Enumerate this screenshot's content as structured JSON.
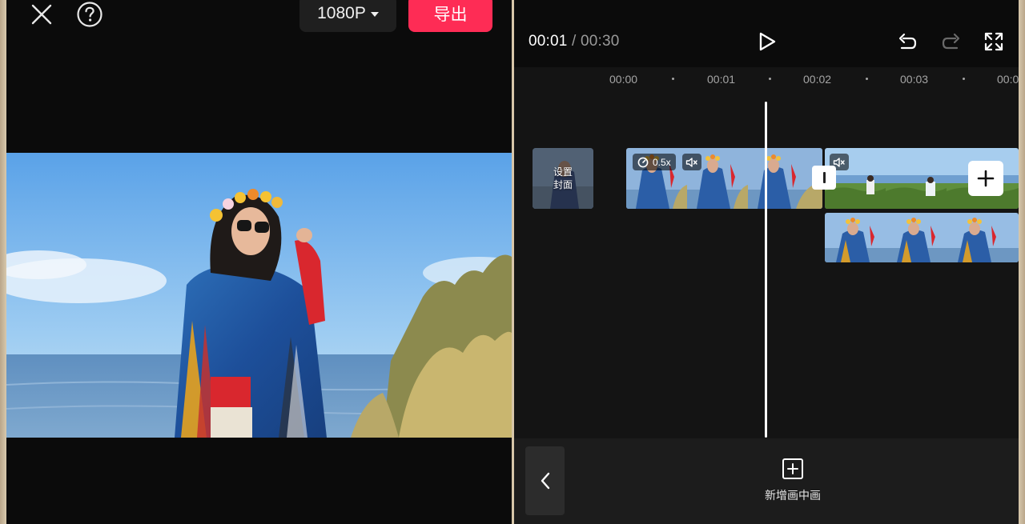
{
  "export_panel": {
    "resolution_label": "1080P",
    "export_label": "导出"
  },
  "player": {
    "current_time": "00:01",
    "separator": "/",
    "total_time": "00:30"
  },
  "timeline": {
    "ruler": [
      "00:00",
      "00:01",
      "00:02",
      "00:03",
      "00:0"
    ],
    "cover_label_line1": "设置",
    "cover_label_line2": "封面",
    "speed_value": "0.5x"
  },
  "bottom": {
    "pip_label": "新增画中画"
  },
  "colors": {
    "export_accent": "#fe2c55",
    "background": "#141414"
  },
  "icons": [
    "close-icon",
    "help-icon",
    "caret-down-icon",
    "play-icon",
    "undo-icon",
    "redo-icon",
    "fullscreen-icon",
    "speed-icon",
    "mute-icon",
    "plus-icon",
    "chevron-left-icon",
    "add-square-icon"
  ]
}
